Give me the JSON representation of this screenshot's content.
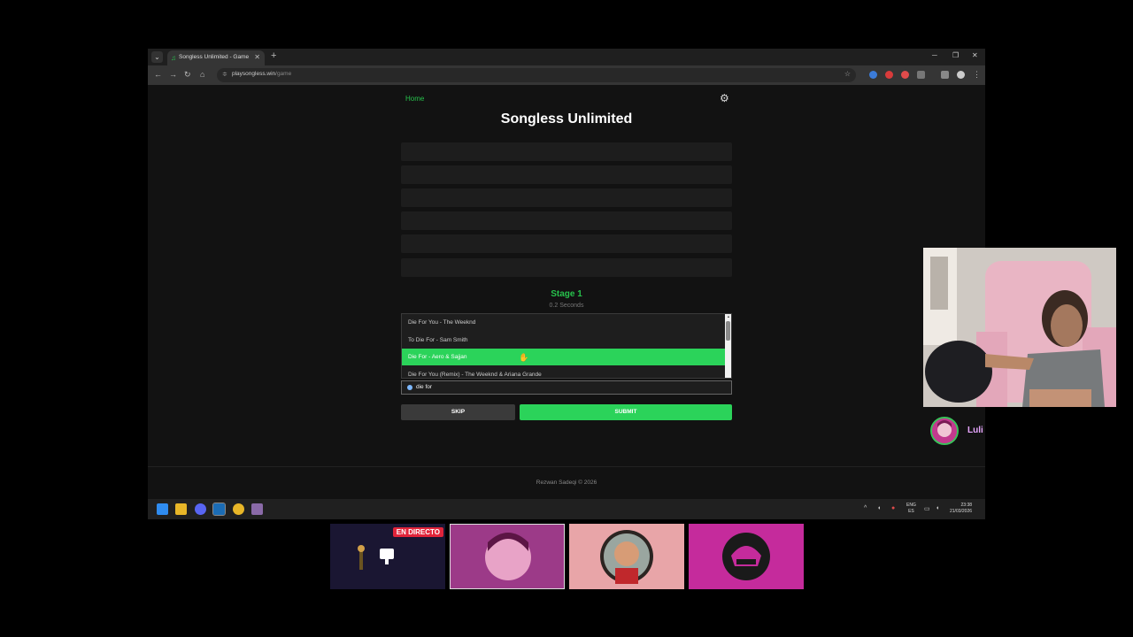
{
  "browser": {
    "tab_title": "Songless Unlimited - Game",
    "url_domain": "playsongless.win",
    "url_path": "/game"
  },
  "page": {
    "home_link": "Home",
    "title": "Songless Unlimited",
    "stage_label": "Stage 1",
    "stage_duration": "0.2 Seconds",
    "suggestions": [
      "Die For You - The Weeknd",
      "To Die For - Sam Smith",
      "Die For - Aero & Sajjan",
      "Die For You (Remix) - The Weeknd & Ariana Grande"
    ],
    "active_suggestion_index": 2,
    "guess_value": "die for",
    "skip_label": "SKIP",
    "submit_label": "SUBMIT",
    "footer": "Rezwan Sadeqi © 2026"
  },
  "taskbar": {
    "lang_top": "ENG",
    "lang_bottom": "ES",
    "time": "23:38",
    "date": "21/03/2026"
  },
  "stream": {
    "streamer_name": "Luli",
    "live_badge": "EN DIRECTO"
  },
  "colors": {
    "accent_green": "#2bd35a",
    "page_bg": "#121212",
    "streamer_name": "#e7a6ff"
  }
}
